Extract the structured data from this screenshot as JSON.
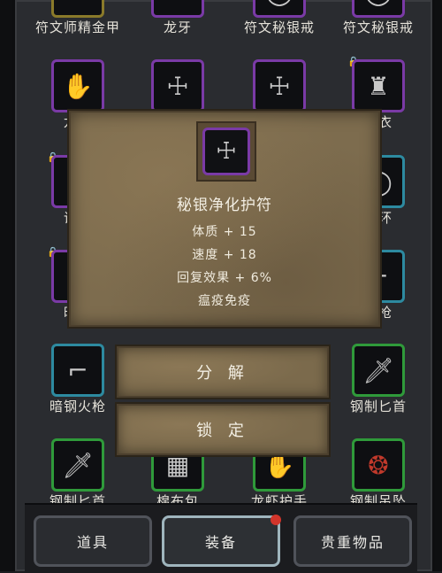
{
  "grid": {
    "row0": [
      "符文师精金甲",
      "龙牙",
      "符文秘银戒",
      "符文秘银戒"
    ],
    "row1": [
      "龙鳞",
      "",
      "",
      "乞衣"
    ],
    "row2": [
      "议会",
      "",
      "",
      "指环"
    ],
    "row3": [
      "暗钢",
      "",
      "",
      "猎枪"
    ],
    "row4": [
      "暗钢火枪",
      "",
      "",
      "钢制匕首"
    ],
    "row5": [
      "钢制匕首",
      "棉布包",
      "龙虾护手",
      "钢制吊坠"
    ]
  },
  "tooltip": {
    "name": "秘银净化护符",
    "stats": [
      "体质 + 15",
      "速度 + 18",
      "回复效果 + 6%",
      "瘟疫免疫"
    ]
  },
  "actions": {
    "decompose": "分 解",
    "lock": "锁 定"
  },
  "tabs": {
    "items": "道具",
    "equipment": "装备",
    "valuables": "贵重物品"
  },
  "colors": {
    "epic_border": "#7a3aa6",
    "rare_border": "#2d8aa0",
    "uncommon_border": "#2f9a3a",
    "parchment": "#7d6c4e",
    "badge": "#d2352b"
  }
}
